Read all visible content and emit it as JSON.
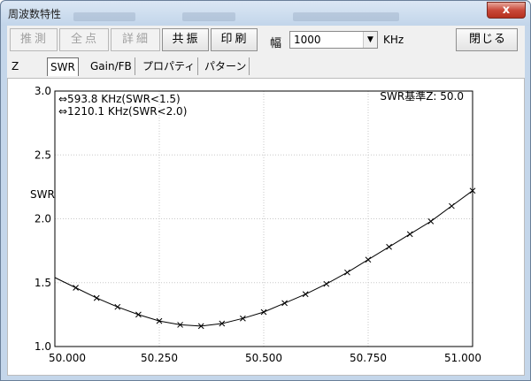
{
  "window": {
    "title": "周波数特性",
    "close_label": "x"
  },
  "toolbar": {
    "estimate_label": "推測",
    "all_points_label": "全点",
    "details_label": "詳細",
    "resonance_label": "共振",
    "print_label": "印刷",
    "width_label": "幅",
    "width_value": "1000",
    "width_unit": "KHz",
    "close_label": "閉じる"
  },
  "tabs": [
    {
      "label": "Z"
    },
    {
      "label": "SWR"
    },
    {
      "label": "Gain/FB"
    },
    {
      "label": "プロパティ"
    },
    {
      "label": "パターン"
    }
  ],
  "active_tab": "SWR",
  "chart_data": {
    "type": "line",
    "ylabel": "SWR",
    "xlim": [
      50.0,
      51.0
    ],
    "ylim": [
      1.0,
      3.0
    ],
    "x_ticks": [
      "50.000",
      "50.250",
      "50.500",
      "50.750",
      "51.000"
    ],
    "y_ticks": [
      "1.0",
      "1.5",
      "2.0",
      "2.5",
      "3.0"
    ],
    "grid": true,
    "marker": "x",
    "annotations": [
      "⇔593.8 KHz(SWR<1.5)",
      "⇔1210.1 KHz(SWR<2.0)"
    ],
    "impedance_note": "SWR基準Z: 50.0",
    "x": [
      50.0,
      50.05,
      50.1,
      50.15,
      50.2,
      50.25,
      50.3,
      50.35,
      50.4,
      50.45,
      50.5,
      50.55,
      50.6,
      50.65,
      50.7,
      50.75,
      50.8,
      50.85,
      50.9,
      50.95,
      51.0
    ],
    "y": [
      1.54,
      1.46,
      1.38,
      1.31,
      1.25,
      1.2,
      1.17,
      1.16,
      1.18,
      1.22,
      1.27,
      1.34,
      1.41,
      1.49,
      1.58,
      1.68,
      1.78,
      1.88,
      1.98,
      2.1,
      2.22
    ]
  }
}
